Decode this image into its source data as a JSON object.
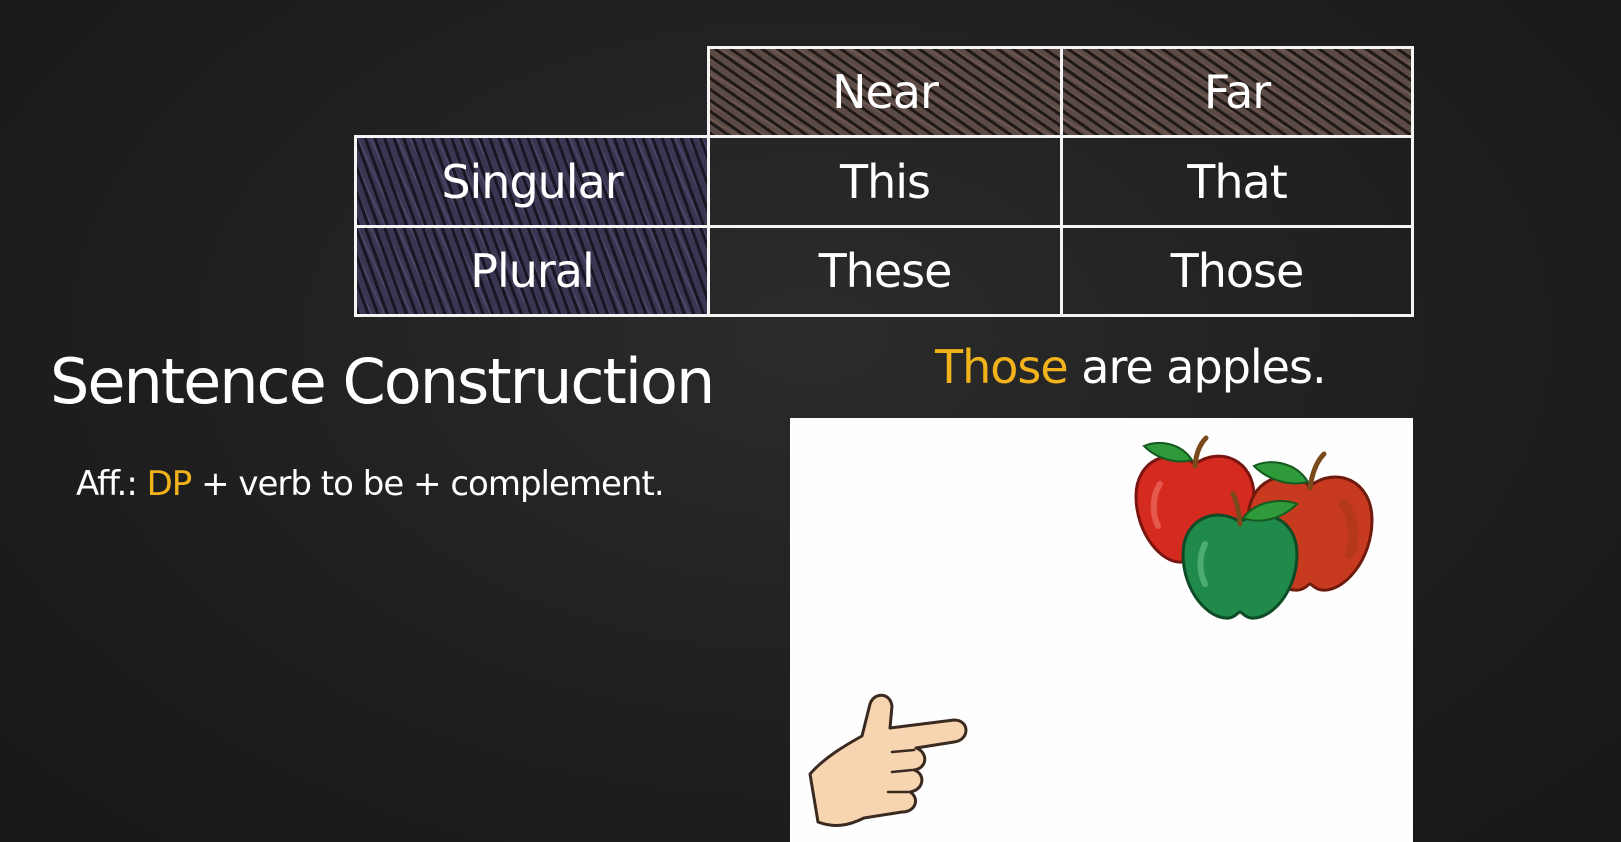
{
  "table": {
    "col_headers": [
      "Near",
      "Far"
    ],
    "rows": [
      {
        "label": "Singular",
        "near": "This",
        "far": "That"
      },
      {
        "label": "Plural",
        "near": "These",
        "far": "Those"
      }
    ]
  },
  "section": {
    "title": "Sentence Construction",
    "formula_prefix": "Aff.: ",
    "formula_highlight": "DP",
    "formula_rest": " + verb to be + complement."
  },
  "example": {
    "highlight": "Those",
    "rest": " are apples."
  },
  "illustration": {
    "icons": [
      "red-apple-icon",
      "red-apple-icon",
      "green-apple-icon",
      "pointing-hand-icon"
    ]
  },
  "colors": {
    "accent_yellow": "#f2b21a",
    "header_brown": "#5c4a45",
    "row_label_purple": "#3b3552",
    "background": "#1f1f1f"
  }
}
